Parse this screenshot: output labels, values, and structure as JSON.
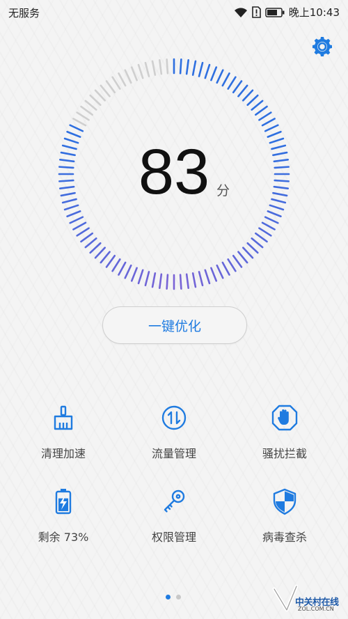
{
  "status_bar": {
    "carrier": "无服务",
    "time": "晚上10:43"
  },
  "gauge": {
    "score": "83",
    "unit": "分",
    "score_percent": 83
  },
  "optimize_label": "一键优化",
  "features": [
    {
      "label": "清理加速",
      "icon": "broom-icon"
    },
    {
      "label": "流量管理",
      "icon": "data-traffic-icon"
    },
    {
      "label": "骚扰拦截",
      "icon": "block-hand-icon"
    },
    {
      "label": "剩余 73%",
      "icon": "battery-icon",
      "battery_percent": 73
    },
    {
      "label": "权限管理",
      "icon": "key-icon"
    },
    {
      "label": "病毒查杀",
      "icon": "shield-icon"
    }
  ],
  "pager": {
    "count": 2,
    "active": 0
  },
  "watermark": {
    "text": "中关村在线",
    "sub": "ZOL.COM.CN"
  },
  "colors": {
    "accent": "#1f7be0",
    "gauge_blue": "#2e6fe0",
    "gauge_purple": "#7a63d6",
    "gauge_inactive": "#cfcfcf"
  }
}
